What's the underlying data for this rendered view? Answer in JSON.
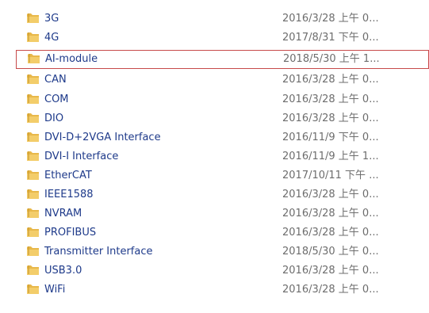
{
  "icons": {
    "folder": "folder-icon"
  },
  "colors": {
    "name_text": "#1e3a8a",
    "date_text": "#6d6d6d",
    "selection_border": "#c74a4a",
    "folder_fill": "#e8b84a"
  },
  "files": [
    {
      "name": "3G",
      "modified": "2016/3/28 上午 0..."
    },
    {
      "name": "4G",
      "modified": "2017/8/31 下午 0..."
    },
    {
      "name": "AI-module",
      "modified": "2018/5/30 上午 1...",
      "selected": true
    },
    {
      "name": "CAN",
      "modified": "2016/3/28 上午 0..."
    },
    {
      "name": "COM",
      "modified": "2016/3/28 上午 0..."
    },
    {
      "name": "DIO",
      "modified": "2016/3/28 上午 0..."
    },
    {
      "name": "DVI-D+2VGA Interface",
      "modified": "2016/11/9 下午 0..."
    },
    {
      "name": "DVI-I Interface",
      "modified": "2016/11/9 上午 1..."
    },
    {
      "name": "EtherCAT",
      "modified": "2017/10/11 下午 ..."
    },
    {
      "name": "IEEE1588",
      "modified": "2016/3/28 上午 0..."
    },
    {
      "name": "NVRAM",
      "modified": "2016/3/28 上午 0..."
    },
    {
      "name": "PROFIBUS",
      "modified": "2016/3/28 上午 0..."
    },
    {
      "name": "Transmitter Interface",
      "modified": "2018/5/30 上午 0..."
    },
    {
      "name": "USB3.0",
      "modified": "2016/3/28 上午 0..."
    },
    {
      "name": "WiFi",
      "modified": "2016/3/28 上午 0..."
    }
  ]
}
